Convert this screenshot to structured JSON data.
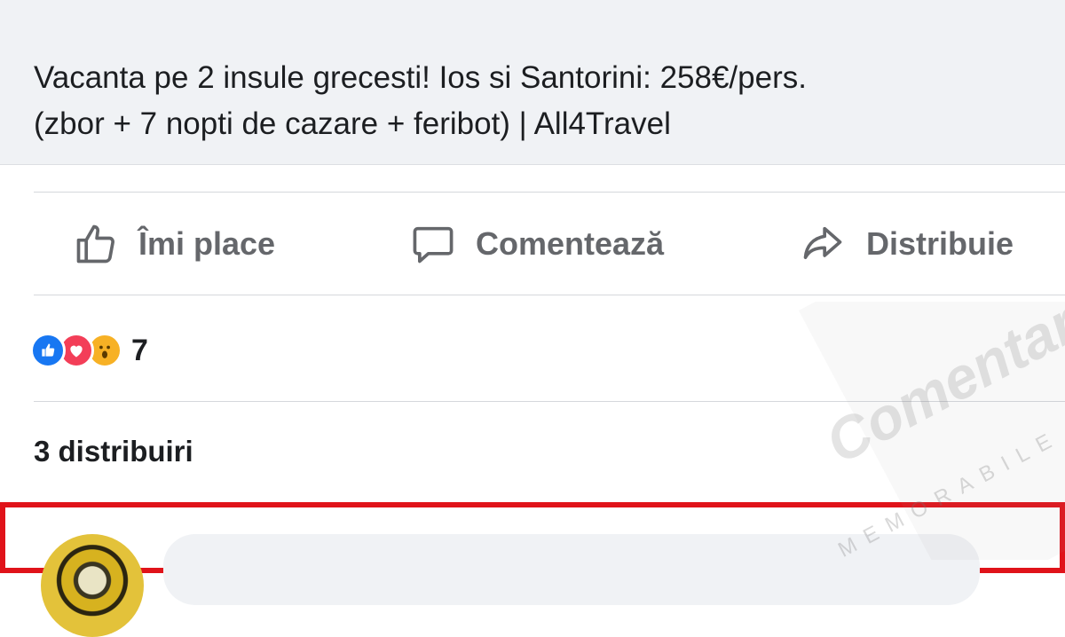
{
  "post": {
    "link_title_line1": "Vacanta pe 2 insule grecesti! Ios si Santorini: 258€/pers.",
    "link_title_line2": "(zbor + 7 nopti de cazare + feribot) | All4Travel"
  },
  "actions": {
    "like_label": "Îmi place",
    "comment_label": "Comentează",
    "share_label": "Distribuie"
  },
  "reactions": {
    "types": [
      "like",
      "love",
      "wow"
    ],
    "count": "7"
  },
  "shares": {
    "label": "3 distribuiri"
  },
  "watermark": {
    "brand": "Comentarii",
    "tagline": "MEMORABILE"
  },
  "colors": {
    "like_blue": "#1877f2",
    "love_red": "#f33e58",
    "wow_yellow": "#f7b125",
    "highlight_red": "#e0131a",
    "action_gray": "#65676b"
  }
}
